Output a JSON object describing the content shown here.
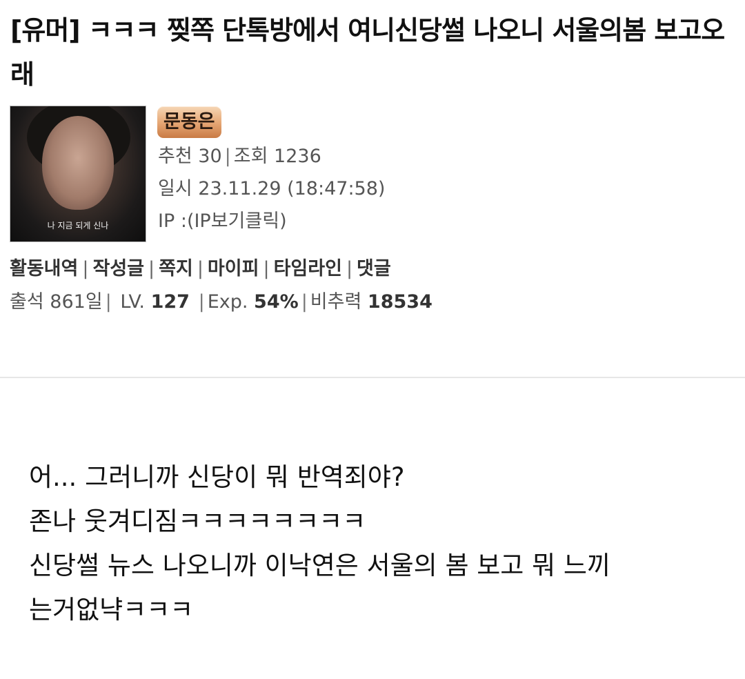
{
  "post": {
    "title": "[유머] ㅋㅋㅋ 찢쪽 단톡방에서 여니신당썰 나오니 서울의봄 보고오래"
  },
  "author": {
    "avatar_caption": "나 지금 되게 신나",
    "nickname": "문동은",
    "recommend_label": "추천",
    "recommend_count": "30",
    "views_label": "조회",
    "views_count": "1236",
    "date_label": "일시",
    "date_value": "23.11.29 (18:47:58)",
    "ip_label": "IP :",
    "ip_value": "(IP보기클릭)"
  },
  "links": {
    "activity": "활동내역",
    "posts": "작성글",
    "message": "쪽지",
    "mypi": "마이피",
    "timeline": "타임라인",
    "comments": "댓글"
  },
  "stats": {
    "attendance_label": "출석",
    "attendance_value": "861일",
    "lv_label": "LV.",
    "lv_value": "127",
    "exp_label": "Exp.",
    "exp_value": "54%",
    "nonrec_label": "비추력",
    "nonrec_value": "18534"
  },
  "content": {
    "lines": [
      "어... 그러니까 신당이 뭐 반역죄야?",
      "존나 웃겨디짐ㅋㅋㅋㅋㅋㅋㅋㅋ",
      "신당썰 뉴스 나오니까 이낙연은 서울의 봄 보고 뭐 느끼",
      "는거없냑ㅋㅋㅋ"
    ]
  }
}
